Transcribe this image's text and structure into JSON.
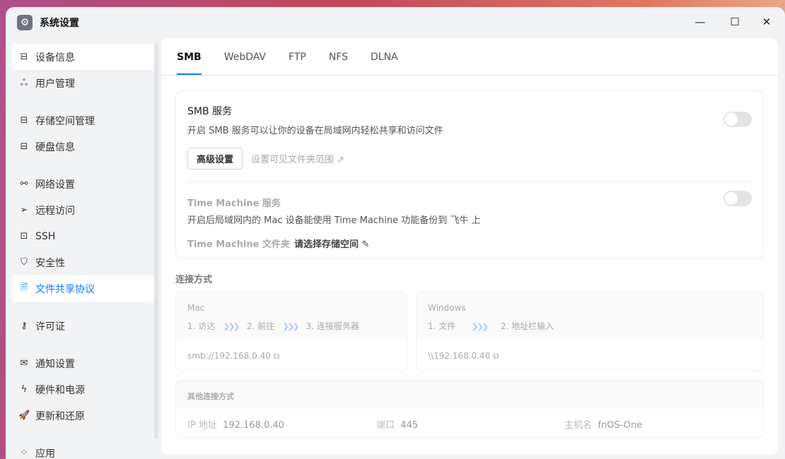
{
  "window": {
    "title": "系统设置",
    "minimize": "—",
    "maximize": "☐",
    "close": "✕"
  },
  "sidebar": {
    "items": [
      {
        "label": "设备信息",
        "icon": "drive-icon"
      },
      {
        "label": "用户管理",
        "icon": "users-icon"
      },
      {
        "label": "存储空间管理",
        "icon": "storage-icon"
      },
      {
        "label": "硬盘信息",
        "icon": "disk-icon"
      },
      {
        "label": "网络设置",
        "icon": "network-icon"
      },
      {
        "label": "远程访问",
        "icon": "send-icon"
      },
      {
        "label": "SSH",
        "icon": "code-icon"
      },
      {
        "label": "安全性",
        "icon": "shield-icon"
      },
      {
        "label": "文件共享协议",
        "icon": "document-icon"
      },
      {
        "label": "许可证",
        "icon": "key-icon"
      },
      {
        "label": "通知设置",
        "icon": "mail-icon"
      },
      {
        "label": "硬件和电源",
        "icon": "power-icon"
      },
      {
        "label": "更新和还原",
        "icon": "rocket-icon"
      },
      {
        "label": "应用",
        "icon": "apps-icon"
      }
    ]
  },
  "tabs": [
    "SMB",
    "WebDAV",
    "FTP",
    "NFS",
    "DLNA"
  ],
  "smb": {
    "title": "SMB 服务",
    "desc": "开启 SMB 服务可以让你的设备在局域网内轻松共享和访问文件",
    "advanced": "高级设置",
    "visible_scope": "设置可见文件夹范围",
    "enabled": false
  },
  "tm": {
    "title": "Time Machine 服务",
    "desc": "开启后局域网内的 Mac 设备能使用 Time Machine 功能备份到 飞牛 上",
    "folder_label": "Time Machine 文件夹",
    "folder_value": "请选择存储空间",
    "enabled": false
  },
  "connect": {
    "title": "连接方式",
    "mac": {
      "name": "Mac",
      "step1": "1. 访达",
      "step2": "2. 前往",
      "step3": "3. 连接服务器",
      "address": "smb://192.168.0.40"
    },
    "windows": {
      "name": "Windows",
      "step1": "1. 文件",
      "step2": "2. 地址栏输入",
      "address": "\\\\192.168.0.40"
    },
    "other": {
      "title": "其他连接方式",
      "ip_label": "IP 地址",
      "ip": "192.168.0.40",
      "port_label": "端口",
      "port": "445",
      "host_label": "主机名",
      "host": "fnOS-One"
    },
    "arrow": "❯❯❯"
  }
}
